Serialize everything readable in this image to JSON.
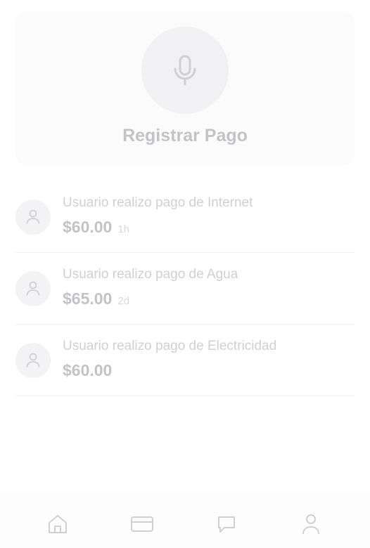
{
  "register_card": {
    "title": "Registrar Pago",
    "icon": "microphone-icon"
  },
  "payments": [
    {
      "description": "Usuario realizo pago de Internet",
      "amount": "$60.00",
      "time": "1h"
    },
    {
      "description": "Usuario realizo pago de Agua",
      "amount": "$65.00",
      "time": "2d"
    },
    {
      "description": "Usuario realizo pago de Electricidad",
      "amount": "$60.00",
      "time": ""
    }
  ],
  "bottom_nav": {
    "items": [
      "home-icon",
      "card-icon",
      "chat-icon",
      "profile-icon"
    ]
  },
  "colors": {
    "card_bg": "#fbfbfb",
    "text_muted": "#c2c3c7",
    "avatar_bg": "#f3f3f5",
    "icon": "#cfd0d4"
  }
}
